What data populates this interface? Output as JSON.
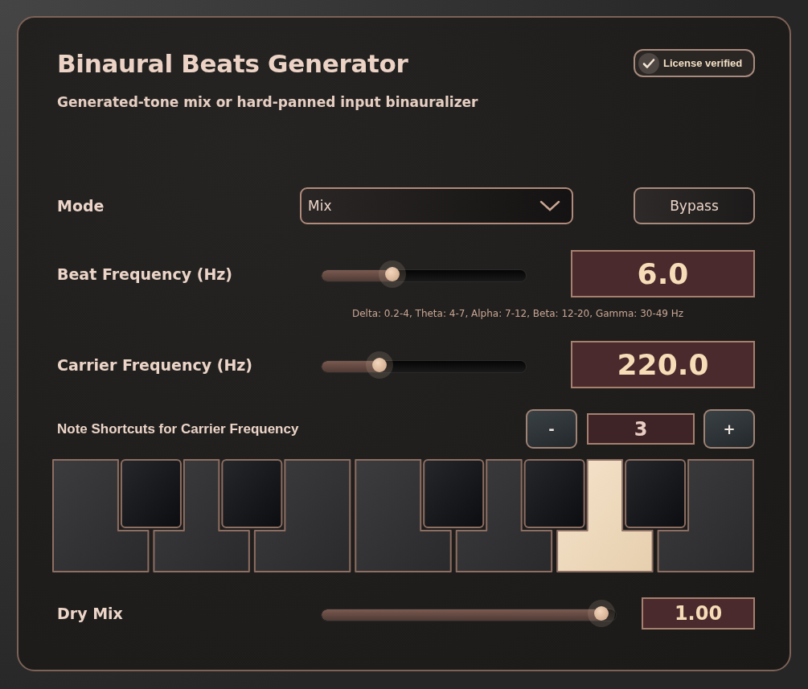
{
  "header": {
    "title": "Binaural Beats Generator",
    "subtitle": "Generated-tone mix or hard-panned input binauralizer",
    "license": {
      "label": "License verified",
      "checked": true
    }
  },
  "mode": {
    "label": "Mode",
    "value": "Mix",
    "bypass": "Bypass"
  },
  "beat": {
    "label": "Beat Frequency (Hz)",
    "level": 0.35,
    "value": "6.0",
    "hint": "Delta: 0.2-4, Theta: 4-7, Alpha: 7-12, Beta: 12-20, Gamma: 30-49 Hz"
  },
  "carrier": {
    "label": "Carrier Frequency (Hz)",
    "level": 0.28,
    "value": "220.0"
  },
  "notes": {
    "label": "Note Shortcuts for Carrier Frequency",
    "decrement": "-",
    "octave": "3",
    "increment": "+",
    "keys": [
      {
        "kind": "white",
        "selected": false
      },
      {
        "kind": "black",
        "selected": false
      },
      {
        "kind": "white",
        "selected": false
      },
      {
        "kind": "black",
        "selected": false
      },
      {
        "kind": "white",
        "selected": false
      },
      {
        "kind": "white",
        "selected": false
      },
      {
        "kind": "black",
        "selected": false
      },
      {
        "kind": "white",
        "selected": false
      },
      {
        "kind": "black",
        "selected": false
      },
      {
        "kind": "white",
        "selected": true
      },
      {
        "kind": "black",
        "selected": false
      },
      {
        "kind": "white",
        "selected": false
      }
    ]
  },
  "dry_mix": {
    "label": "Dry Mix",
    "level": 1,
    "value": "1.00"
  }
}
